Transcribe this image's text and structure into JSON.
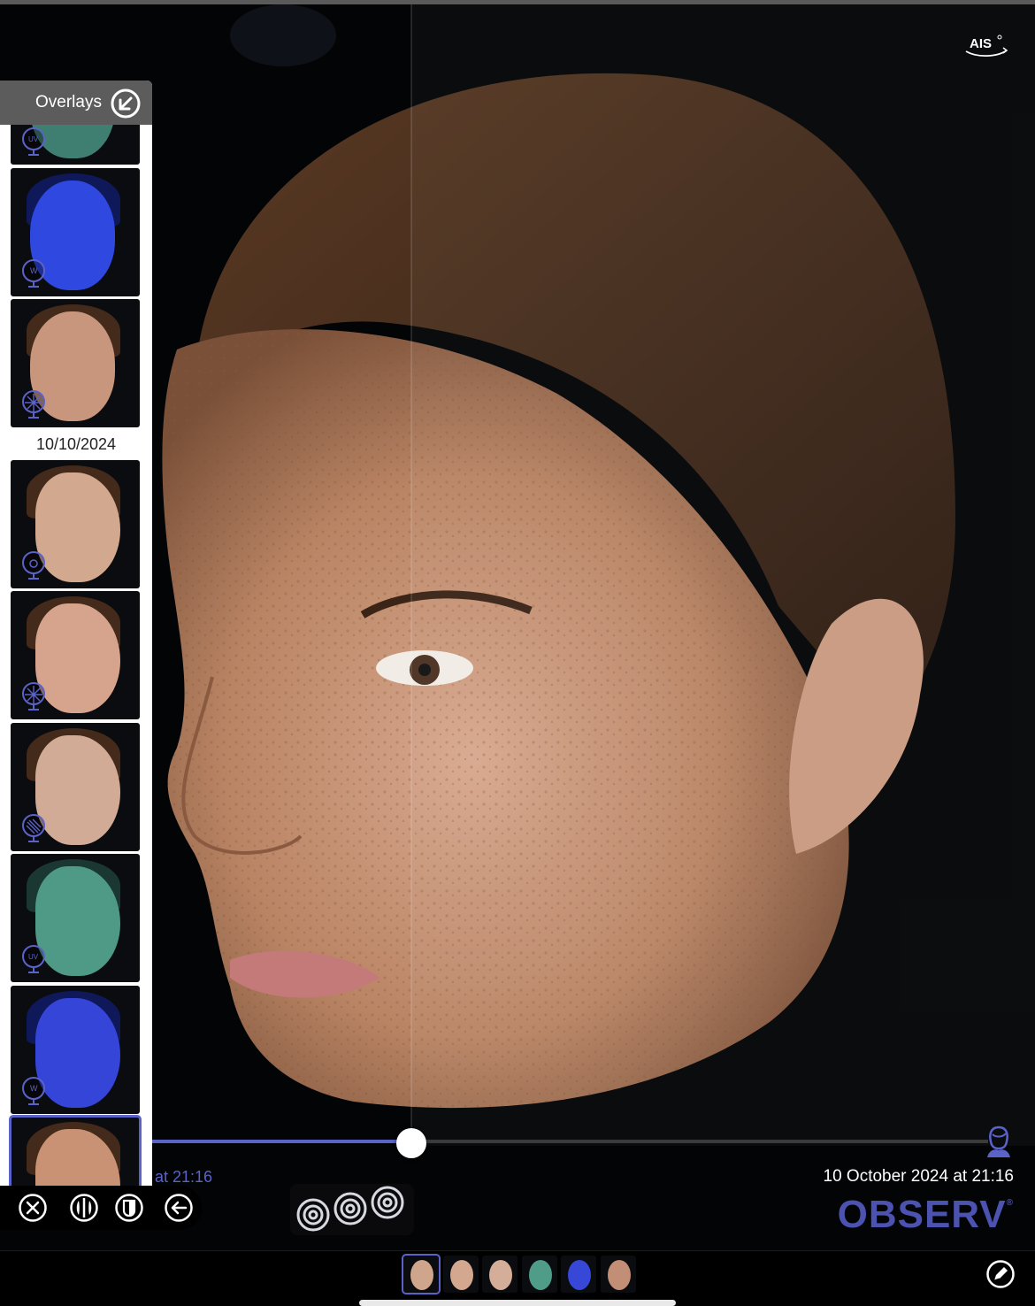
{
  "app": {
    "brand": "OBSERV",
    "brand_mark": "®",
    "logo_text": "AIS",
    "accent": "#5b62c8"
  },
  "overlays_panel": {
    "title": "Overlays",
    "collapse_icon": "collapse-arrow-icon",
    "session_date": "10/10/2024",
    "earlier_thumbs": [
      {
        "view": "frontal",
        "light": "uv",
        "skin": "#3f7f72"
      },
      {
        "view": "frontal",
        "light": "wood",
        "skin": "#2f48e0"
      },
      {
        "view": "frontal",
        "light": "cross-polarized",
        "skin": "#c8957d"
      }
    ],
    "session_thumbs": [
      {
        "view": "left-oblique",
        "light": "daylight",
        "skin": "#d2a98e"
      },
      {
        "view": "left-oblique",
        "light": "cross-polarized",
        "skin": "#d6a48d"
      },
      {
        "view": "left-oblique",
        "light": "parallel-polarized",
        "skin": "#d2ab96"
      },
      {
        "view": "left-oblique",
        "light": "uv",
        "skin": "#4e9a86"
      },
      {
        "view": "left-oblique",
        "light": "wood",
        "skin": "#3545d8"
      },
      {
        "view": "left-oblique",
        "light": "cross-polarized",
        "skin": "#c99275",
        "selected": true
      }
    ]
  },
  "comparison": {
    "left_timestamp": "at 21:16",
    "right_timestamp": "10 October 2024 at 21:16",
    "slider_position": 0.31
  },
  "toolbar": {
    "buttons": [
      "close-icon",
      "split-view-icon",
      "overlay-mask-icon",
      "back-icon"
    ]
  },
  "bottom_strip": {
    "thumbs": [
      {
        "skin": "#cfa68c",
        "selected": true
      },
      {
        "skin": "#d3a88f"
      },
      {
        "skin": "#d4ae98"
      },
      {
        "skin": "#4f9c88"
      },
      {
        "skin": "#3747d8"
      },
      {
        "skin": "#c38e76"
      }
    ],
    "edit_icon": "edit-pencil-icon"
  }
}
